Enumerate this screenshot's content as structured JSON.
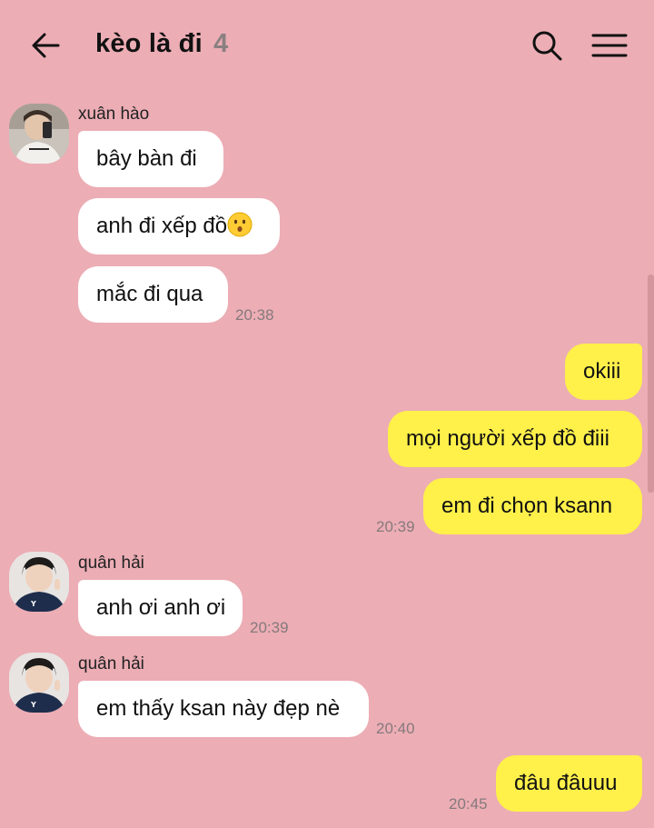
{
  "header": {
    "title": "kèo là đi",
    "member_count": "4",
    "back_icon": "arrow-left-icon",
    "search_icon": "search-icon",
    "menu_icon": "hamburger-menu-icon"
  },
  "colors": {
    "background": "#ecadb5",
    "incoming_bubble": "#ffffff",
    "outgoing_bubble": "#fff04a"
  },
  "messages": [
    {
      "sender": "xuân hào",
      "direction": "in",
      "text": "bây bàn đi"
    },
    {
      "sender": "xuân hào",
      "direction": "in",
      "text": "anh đi xếp đồ",
      "emoji": "kissing-face-emoji"
    },
    {
      "sender": "xuân hào",
      "direction": "in",
      "text": "mắc đi qua",
      "time": "20:38"
    },
    {
      "direction": "out",
      "text": "okiii"
    },
    {
      "direction": "out",
      "text": "mọi người xếp đồ điii"
    },
    {
      "direction": "out",
      "text": "em đi chọn ksann",
      "time": "20:39"
    },
    {
      "sender": "quân hải",
      "direction": "in",
      "text": "anh ơi anh ơi",
      "time": "20:39"
    },
    {
      "sender": "quân hải",
      "direction": "in",
      "text": "em thấy ksan này đẹp nè",
      "time": "20:40"
    },
    {
      "direction": "out",
      "text": "đâu đâuuu",
      "time": "20:45"
    }
  ]
}
